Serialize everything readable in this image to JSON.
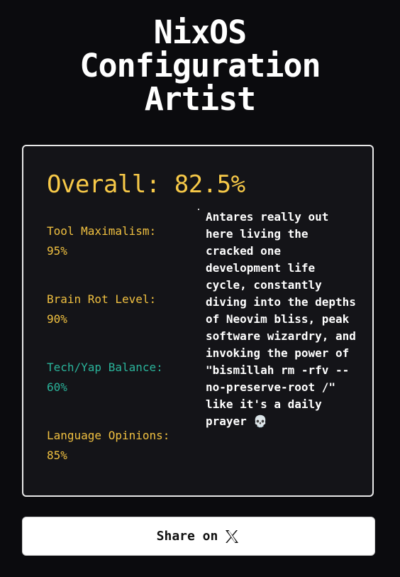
{
  "title": {
    "line1": "NixOS",
    "line2": "Configuration",
    "line3": "Artist"
  },
  "card": {
    "overall": "Overall: 82.5%",
    "metrics": [
      {
        "name": "Tool Maximalism:",
        "value": "95%",
        "color": "#f0c040"
      },
      {
        "name": "Brain Rot Level:",
        "value": "90%",
        "color": "#f0c040"
      },
      {
        "name": "Tech/Yap Balance:",
        "value": "60%",
        "color": "#2ab39a"
      },
      {
        "name": "Language Opinions:",
        "value": "85%",
        "color": "#f0c040"
      }
    ],
    "description": "Antares really out here living the cracked one development life cycle, constantly diving into the depths of Neovim bliss, peak software wizardry, and invoking the power of \"bismillah rm -rfv --no-preserve-root /\" like it's a daily prayer 💀"
  },
  "share": {
    "label": "Share on",
    "icon": "x-logo-icon"
  },
  "colors": {
    "background": "#0b0b0e",
    "card_background": "#141418",
    "accent_yellow": "#f7c948",
    "accent_teal": "#2ab39a"
  }
}
